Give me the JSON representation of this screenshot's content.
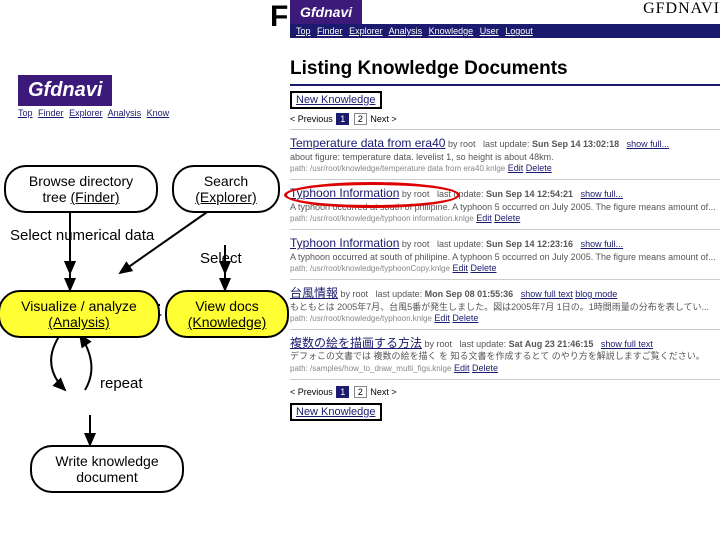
{
  "big_letter": "F",
  "app": {
    "logo": "Gfdnavi",
    "logo_sm": "Gfdnavi",
    "caps": "GFDNAVI"
  },
  "nav_top": {
    "links": [
      "Top",
      "Finder",
      "Explorer",
      "Analysis",
      "Knowledge",
      "User",
      "Logout"
    ]
  },
  "nav_left": {
    "links": [
      "Top",
      "Finder",
      "Explorer",
      "Analysis",
      "Know"
    ]
  },
  "listing": {
    "title": "Listing Knowledge Documents",
    "new": "New Knowledge",
    "prev": "< Previous",
    "next": "Next >",
    "pages": [
      "1",
      "2"
    ]
  },
  "docs": [
    {
      "title": "Temperature data from era40",
      "by": "by  root",
      "update": "last update:",
      "date": "Sun Sep 14 13:02:18",
      "show": "show full...",
      "desc": "about figure: temperature data. levelist 1, so height is about 48km.",
      "path": "path: /usr/root/knowledge/temperature data from era40.knlge",
      "edit": "Edit",
      "del": "Delete"
    },
    {
      "title": "Typhoon Information",
      "by": "by  root",
      "update": "last update:",
      "date": "Sun Sep 14 12:54:21",
      "show": "show full...",
      "desc": "A typhoon occurred at south of philipine. A typhoon 5 occurred on July 2005. The figure means amount of...",
      "path": "path: /usr/root/knowledge/typhoon information.knlge",
      "edit": "Edit",
      "del": "Delete",
      "circled": true
    },
    {
      "title": "Typhoon Information",
      "by": "by root",
      "update": "last update:",
      "date": "Sun Sep 14 12:23:16",
      "show": "show full...",
      "desc": "A typhoon occurred at south of philipine. A typhoon 5 occurred on July 2005. The figure means amount of...",
      "path": "path: /usr/root/knowledge/typhoonCopy.knlge",
      "edit": "Edit",
      "del": "Delete"
    },
    {
      "title": "台風情報",
      "by": "by root",
      "update": "last update:",
      "date": "Mon Sep 08 01:55:36",
      "show": "show full text",
      "blog": "blog mode",
      "desc": "もともとは 2005年7月、台風5番が発生しました。図は2005年7月 1日の。1時間雨量の分布を表してい...",
      "path": "path: /usr/root/knowledge/typhoon.knlge",
      "edit": "Edit",
      "del": "Delete"
    },
    {
      "title": "複数の絵を描画する方法",
      "by": "by root",
      "update": "last update:",
      "date": "Sat Aug 23 21:46:15",
      "show": "show full text",
      "desc": "デフォこの文書では 複数の絵を描く を 知る文書を作成するとて のやり方を解説しますご覧ください。",
      "path": "path: /samples/how_to_draw_multi_figs.knlge",
      "edit": "Edit",
      "del": "Delete"
    }
  ],
  "flow": {
    "browse": {
      "l1": "Browse directory",
      "l2": "tree ",
      "u": "(Finder)"
    },
    "search": {
      "l1": "Search",
      "u": "(Explorer)"
    },
    "selectnum": "Select numerical data",
    "select": "Select",
    "visualize": {
      "l1": "Visualize / analyze",
      "u": "(Analysis)"
    },
    "viewdocs": {
      "l1": "View docs",
      "u": "(Knowledge)"
    },
    "repeat": "repeat",
    "write": {
      "l1": "Write knowledge",
      "l2": "document"
    }
  }
}
